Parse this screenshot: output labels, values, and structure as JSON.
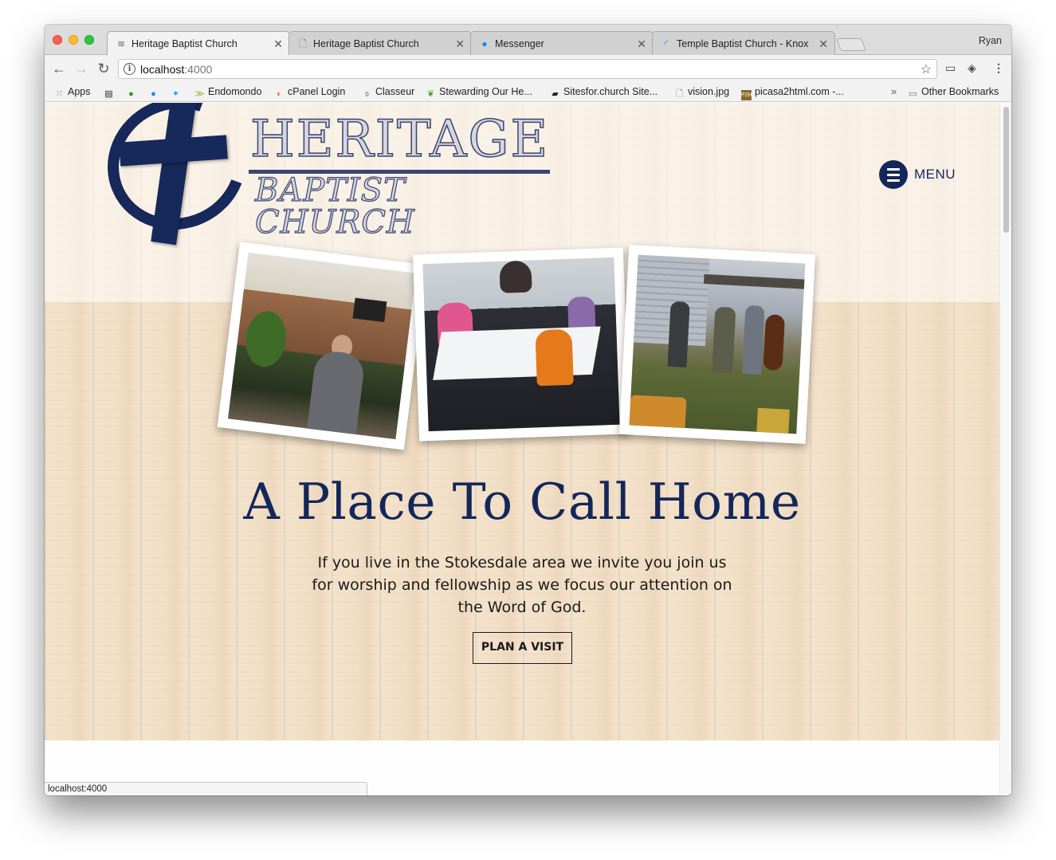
{
  "browser": {
    "tabs": [
      {
        "title": "Heritage Baptist Church",
        "icon": "heritage-favicon",
        "active": true
      },
      {
        "title": "Heritage Baptist Church",
        "icon": "page-icon",
        "active": false
      },
      {
        "title": "Messenger",
        "icon": "messenger-icon",
        "active": false
      },
      {
        "title": "Temple Baptist Church - Knox",
        "icon": "loading-icon",
        "active": false
      }
    ],
    "profile_name": "Ryan",
    "url_host": "localhost",
    "url_port": ":4000",
    "bookmarks": [
      {
        "label": "Apps",
        "icon": "apps-grid-icon"
      },
      {
        "label": "",
        "icon": "book-icon"
      },
      {
        "label": "",
        "icon": "fruit-icon"
      },
      {
        "label": "",
        "icon": "messenger-icon"
      },
      {
        "label": "",
        "icon": "twitter-icon"
      },
      {
        "label": "Endomondo",
        "icon": "endomondo-icon"
      },
      {
        "label": "cPanel Login",
        "icon": "cpanel-icon"
      },
      {
        "label": "Classeur",
        "icon": "clip-icon"
      },
      {
        "label": "Stewarding Our He...",
        "icon": "leaf-icon"
      },
      {
        "label": "Sitesfor.church Site...",
        "icon": "notebook-icon"
      },
      {
        "label": "vision.jpg",
        "icon": "file-icon"
      },
      {
        "label": "picasa2html.com -...",
        "icon": "p2h-icon"
      }
    ],
    "other_bookmarks": "Other Bookmarks",
    "status_text": "localhost:4000"
  },
  "site": {
    "logo": {
      "line1": "HERITAGE",
      "line2": "BAPTIST CHURCH"
    },
    "menu_label": "MENU",
    "hero_title": "A Place To Call Home",
    "hero_text": "If you live in the Stokesdale area we invite you join us for worship and fellowship as we focus our attention on the Word of God.",
    "cta_label": "PLAN A VISIT"
  },
  "colors": {
    "brand_navy": "#14275a",
    "wood_background": "#f2dfc6"
  }
}
